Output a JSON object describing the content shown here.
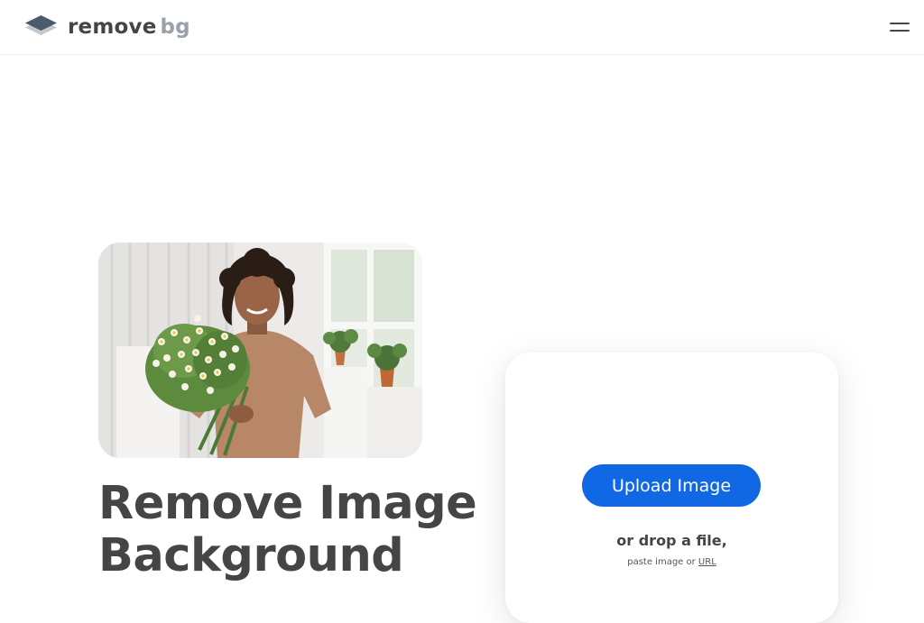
{
  "header": {
    "logo_word1": "remove",
    "logo_word2": "bg",
    "menu_icon": "hamburger-menu-icon"
  },
  "hero": {
    "photo": "woman-holding-flower-bouquet",
    "headline_line1": "Remove Image",
    "headline_line2": "Background"
  },
  "upload": {
    "button_label": "Upload Image",
    "drop_text": "or drop a file,",
    "paste_text": "paste image or",
    "url_link": "URL"
  },
  "colors": {
    "brand_blue": "#1168e4",
    "text_dark": "#454545",
    "logo_gray": "#9aa1a8"
  }
}
